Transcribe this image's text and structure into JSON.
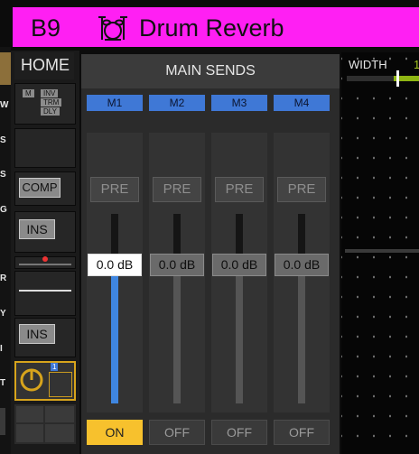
{
  "header": {
    "channel_id": "B9",
    "channel_name": "Drum Reverb",
    "icon": "drum-kit-icon",
    "color": "#ff1ff3"
  },
  "left_strip": {
    "letters": [
      "W",
      "S",
      "S",
      "G",
      "R",
      "Y",
      "I",
      "T"
    ]
  },
  "left_col": {
    "home_label": "HOME",
    "input_tags": [
      "M",
      "INV",
      "TRM",
      "DLY"
    ],
    "comp_label": "COMP",
    "ins1_label": "INS",
    "ins2_label": "INS",
    "fx_badge": "1"
  },
  "main_sends": {
    "title": "MAIN SENDS",
    "channels": [
      {
        "tab": "M1",
        "pre": "PRE",
        "level": "0.0 dB",
        "state": "ON",
        "active": true
      },
      {
        "tab": "M2",
        "pre": "PRE",
        "level": "0.0 dB",
        "state": "OFF",
        "active": false
      },
      {
        "tab": "M3",
        "pre": "PRE",
        "level": "0.0 dB",
        "state": "OFF",
        "active": false
      },
      {
        "tab": "M4",
        "pre": "PRE",
        "level": "0.0 dB",
        "state": "OFF",
        "active": false
      }
    ]
  },
  "right_panel": {
    "width_label": "WIDTH",
    "width_value": "1"
  },
  "colors": {
    "header": "#ff1ff3",
    "send_tab": "#3f78d6",
    "on_button": "#f7c12d",
    "fader_fill": "#3f86e0",
    "width_slider": "#8fb513"
  }
}
